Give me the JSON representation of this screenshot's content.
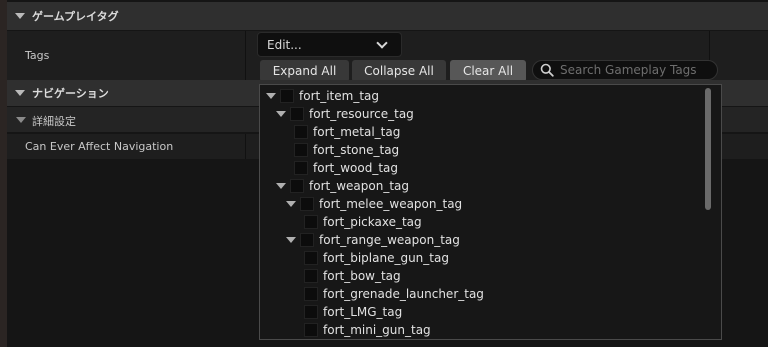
{
  "sections": {
    "gameplay_tags": "ゲームプレイタグ",
    "navigation": "ナビゲーション",
    "advanced": "詳細設定"
  },
  "properties": {
    "tags_label": "Tags",
    "nav_label": "Can Ever Affect Navigation"
  },
  "dropdown": {
    "value": "Edit..."
  },
  "buttons": {
    "expand_all": "Expand All",
    "collapse_all": "Collapse All",
    "clear_all": "Clear All"
  },
  "search": {
    "placeholder": "Search Gameplay Tags",
    "icon": "search-icon"
  },
  "tree": [
    {
      "label": "fort_item_tag",
      "level": 0,
      "expandable": true
    },
    {
      "label": "fort_resource_tag",
      "level": 1,
      "expandable": true
    },
    {
      "label": "fort_metal_tag",
      "level": 2,
      "expandable": false
    },
    {
      "label": "fort_stone_tag",
      "level": 2,
      "expandable": false
    },
    {
      "label": "fort_wood_tag",
      "level": 2,
      "expandable": false
    },
    {
      "label": "fort_weapon_tag",
      "level": 1,
      "expandable": true
    },
    {
      "label": "fort_melee_weapon_tag",
      "level": 2,
      "expandable": true
    },
    {
      "label": "fort_pickaxe_tag",
      "level": 3,
      "expandable": false
    },
    {
      "label": "fort_range_weapon_tag",
      "level": 2,
      "expandable": true
    },
    {
      "label": "fort_biplane_gun_tag",
      "level": 3,
      "expandable": false
    },
    {
      "label": "fort_bow_tag",
      "level": 3,
      "expandable": false
    },
    {
      "label": "fort_grenade_launcher_tag",
      "level": 3,
      "expandable": false
    },
    {
      "label": "fort_LMG_tag",
      "level": 3,
      "expandable": false
    },
    {
      "label": "fort_mini_gun_tag",
      "level": 3,
      "expandable": false
    }
  ]
}
